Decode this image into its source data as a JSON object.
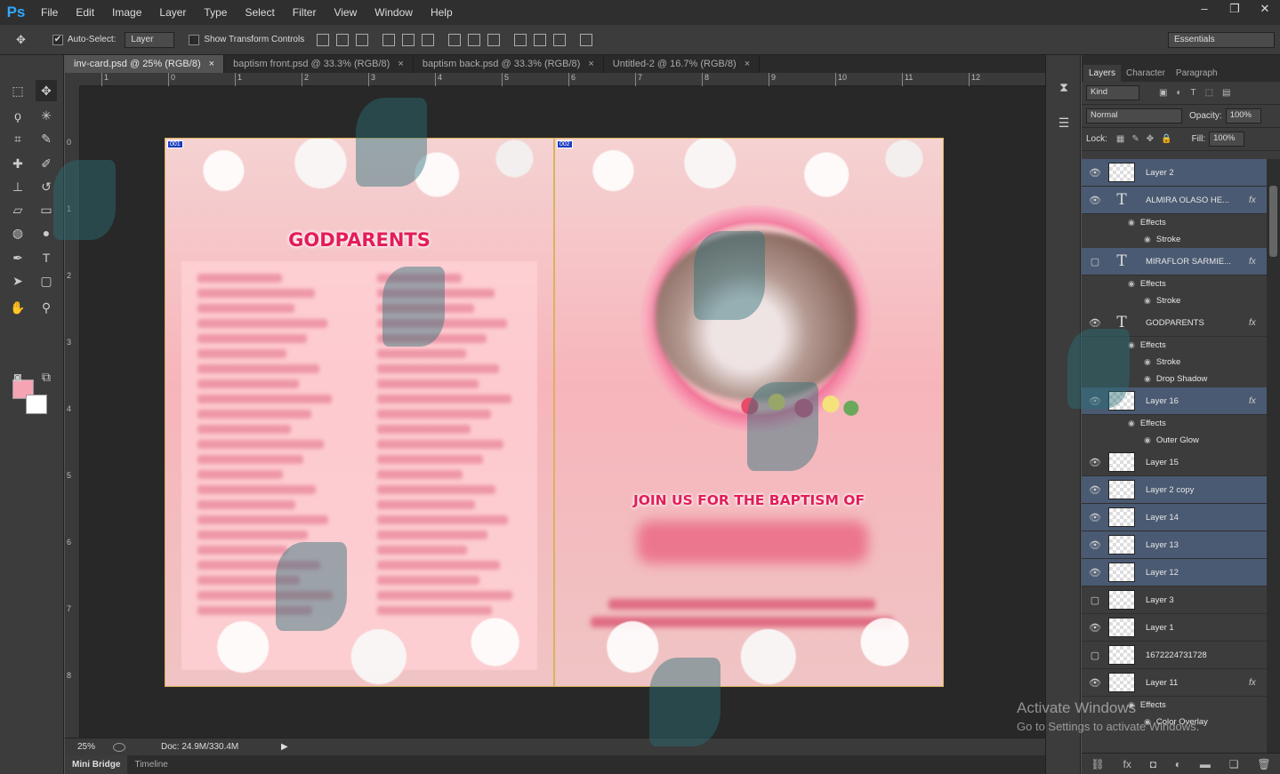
{
  "menubar": {
    "logo": "Ps",
    "items": [
      "File",
      "Edit",
      "Image",
      "Layer",
      "Type",
      "Select",
      "Filter",
      "View",
      "Window",
      "Help"
    ],
    "window_controls": [
      "–",
      "❐",
      "✕"
    ]
  },
  "options": {
    "auto_select_label": "Auto-Select:",
    "auto_select_checked": true,
    "auto_select_value": "Layer",
    "transform_label": "Show Transform Controls",
    "workspace": "Essentials"
  },
  "doc_tabs": [
    {
      "label": "inv-card.psd @ 25% (RGB/8)",
      "active": true
    },
    {
      "label": "baptism front.psd @ 33.3% (RGB/8)",
      "active": false
    },
    {
      "label": "baptism back.psd @ 33.3% (RGB/8)",
      "active": false
    },
    {
      "label": "Untitled-2 @ 16.7% (RGB/8)",
      "active": false
    }
  ],
  "ruler_h": [
    "1",
    "0",
    "1",
    "2",
    "3",
    "4",
    "5",
    "6",
    "7",
    "8",
    "9",
    "10",
    "11",
    "12"
  ],
  "ruler_v": [
    "0",
    "1",
    "2",
    "3",
    "4",
    "5",
    "6",
    "7",
    "8"
  ],
  "canvas": {
    "left_badge": "001",
    "right_badge": "002",
    "godparents_title": "GODPARENTS",
    "join_text": "JOIN US FOR THE BAPTISM OF"
  },
  "status": {
    "zoom": "25%",
    "doc": "Doc: 24.9M/330.4M"
  },
  "bottom_tabs": [
    "Mini Bridge",
    "Timeline"
  ],
  "panel": {
    "tabs": [
      "Layers",
      "Character",
      "Paragraph"
    ],
    "kind_label": "Kind",
    "blend_mode": "Normal",
    "opacity_label": "Opacity:",
    "opacity_value": "100%",
    "lock_label": "Lock:",
    "fill_label": "Fill:",
    "fill_value": "100%"
  },
  "layers": [
    {
      "name": "Layer 2",
      "type": "pixel",
      "visible": true,
      "selected": true,
      "fx": false,
      "effects": []
    },
    {
      "name": "ALMIRA OLASO HE...",
      "type": "text",
      "visible": true,
      "selected": true,
      "fx": true,
      "effects": [
        "Stroke"
      ]
    },
    {
      "name": "MIRAFLOR SARMIE...",
      "type": "text",
      "visible": false,
      "selected": true,
      "fx": true,
      "effects": [
        "Stroke"
      ]
    },
    {
      "name": "GODPARENTS",
      "type": "text",
      "visible": true,
      "selected": false,
      "fx": true,
      "effects": [
        "Stroke",
        "Drop Shadow"
      ]
    },
    {
      "name": "Layer 16",
      "type": "pixel",
      "visible": true,
      "selected": true,
      "fx": true,
      "effects": [
        "Outer Glow"
      ]
    },
    {
      "name": "Layer 15",
      "type": "pixel",
      "visible": true,
      "selected": false,
      "fx": false,
      "effects": []
    },
    {
      "name": "Layer 2 copy",
      "type": "pixel",
      "visible": true,
      "selected": true,
      "fx": false,
      "effects": []
    },
    {
      "name": "Layer 14",
      "type": "pixel",
      "visible": true,
      "selected": true,
      "fx": false,
      "effects": []
    },
    {
      "name": "Layer 13",
      "type": "pixel",
      "visible": true,
      "selected": true,
      "fx": false,
      "effects": []
    },
    {
      "name": "Layer 12",
      "type": "pixel",
      "visible": true,
      "selected": true,
      "fx": false,
      "effects": []
    },
    {
      "name": "Layer 3",
      "type": "pixel",
      "visible": false,
      "selected": false,
      "fx": false,
      "effects": []
    },
    {
      "name": "Layer 1",
      "type": "pixel",
      "visible": true,
      "selected": false,
      "fx": false,
      "effects": []
    },
    {
      "name": "1672224731728",
      "type": "pixel",
      "visible": false,
      "selected": false,
      "fx": false,
      "effects": []
    },
    {
      "name": "Layer 11",
      "type": "pixel",
      "visible": true,
      "selected": false,
      "fx": true,
      "effects": [
        "Color Overlay"
      ]
    }
  ],
  "effects_label": "Effects",
  "activate": {
    "title": "Activate Windows",
    "subtitle": "Go to Settings to activate Windows."
  }
}
